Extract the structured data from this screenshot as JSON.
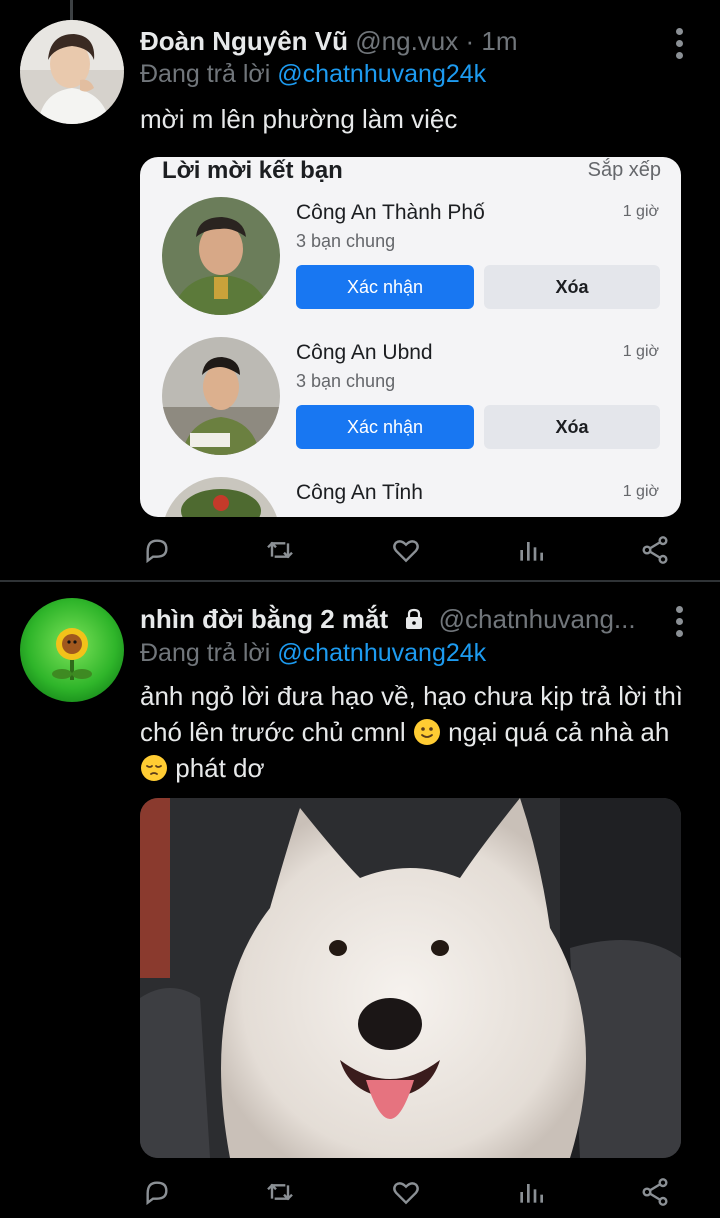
{
  "tweets": [
    {
      "author": {
        "name": "Đoàn Nguyên Vũ",
        "handle": "@ng.vux",
        "separator": "·",
        "time": "1m"
      },
      "reply": {
        "prefix": "Đang trả lời",
        "mention": "@chatnhuvang24k"
      },
      "text": "mời m lên phường làm việc",
      "media": {
        "kind": "facebook-friend-requests-screenshot",
        "title": "Lời mời kết bạn",
        "sort_label": "Sắp xếp",
        "requests": [
          {
            "name": "Công An Thành Phố",
            "mutual": "3 bạn chung",
            "time": "1 giờ",
            "confirm": "Xác nhận",
            "delete": "Xóa"
          },
          {
            "name": "Công An Ubnd",
            "mutual": "3 bạn chung",
            "time": "1 giờ",
            "confirm": "Xác nhận",
            "delete": "Xóa"
          },
          {
            "name": "Công An Tỉnh",
            "time": "1 giờ"
          }
        ]
      }
    },
    {
      "author": {
        "name": "nhìn đời bằng 2 mắt",
        "handle": "@chatnhuvang...",
        "locked": true
      },
      "reply": {
        "prefix": "Đang trả lời",
        "mention": "@chatnhuvang24k"
      },
      "text": {
        "part1": "ảnh ngỏ lời đưa hạo về, hạo chưa kịp trả lời thì chó lên trước chủ cmnl",
        "part2": "ngại quá cả nhà ah",
        "part3": "phát dơ"
      },
      "emojis": [
        "slightly-smiling-face",
        "pensive-face"
      ],
      "media": {
        "kind": "photo-white-samoyed-dog-in-car"
      }
    }
  ],
  "action_icons": [
    "reply-icon",
    "retweet-icon",
    "like-icon",
    "analytics-icon",
    "share-icon"
  ],
  "colors": {
    "background": "#000000",
    "accent": "#1d9bf0",
    "muted": "#71767b",
    "fb_blue": "#1877f2"
  }
}
